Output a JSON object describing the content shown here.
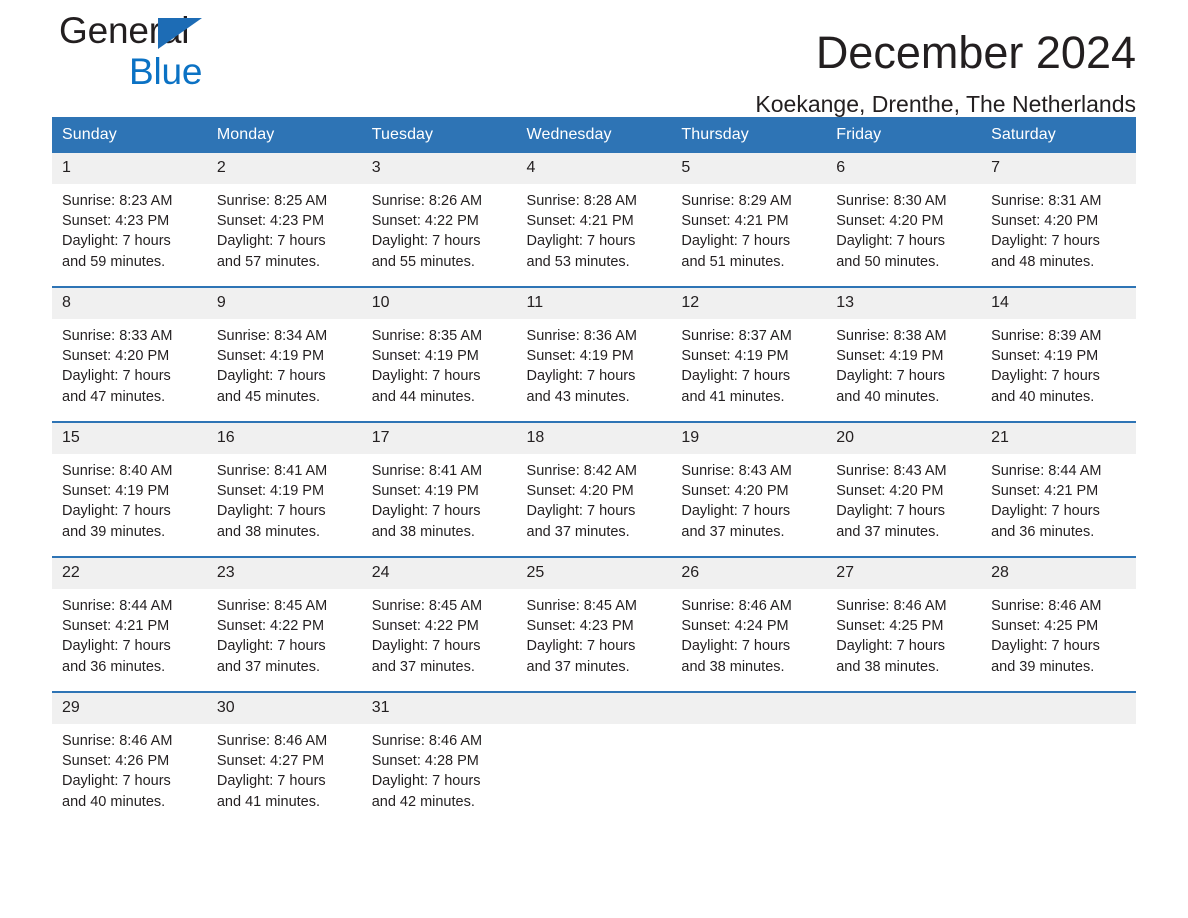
{
  "brand": {
    "line1": "General",
    "line2": "Blue",
    "triangle_color": "#1d6cb5",
    "blue_color": "#0b72c4"
  },
  "header": {
    "title": "December 2024",
    "subtitle": "Koekange, Drenthe, The Netherlands"
  },
  "theme": {
    "header_blue": "#2e74b5",
    "daynum_gray": "#f0f0f0",
    "text": "#231f20"
  },
  "weekdays": [
    "Sunday",
    "Monday",
    "Tuesday",
    "Wednesday",
    "Thursday",
    "Friday",
    "Saturday"
  ],
  "weeks": [
    [
      {
        "day": "1",
        "sunrise": "Sunrise: 8:23 AM",
        "sunset": "Sunset: 4:23 PM",
        "daylight1": "Daylight: 7 hours",
        "daylight2": "and 59 minutes."
      },
      {
        "day": "2",
        "sunrise": "Sunrise: 8:25 AM",
        "sunset": "Sunset: 4:23 PM",
        "daylight1": "Daylight: 7 hours",
        "daylight2": "and 57 minutes."
      },
      {
        "day": "3",
        "sunrise": "Sunrise: 8:26 AM",
        "sunset": "Sunset: 4:22 PM",
        "daylight1": "Daylight: 7 hours",
        "daylight2": "and 55 minutes."
      },
      {
        "day": "4",
        "sunrise": "Sunrise: 8:28 AM",
        "sunset": "Sunset: 4:21 PM",
        "daylight1": "Daylight: 7 hours",
        "daylight2": "and 53 minutes."
      },
      {
        "day": "5",
        "sunrise": "Sunrise: 8:29 AM",
        "sunset": "Sunset: 4:21 PM",
        "daylight1": "Daylight: 7 hours",
        "daylight2": "and 51 minutes."
      },
      {
        "day": "6",
        "sunrise": "Sunrise: 8:30 AM",
        "sunset": "Sunset: 4:20 PM",
        "daylight1": "Daylight: 7 hours",
        "daylight2": "and 50 minutes."
      },
      {
        "day": "7",
        "sunrise": "Sunrise: 8:31 AM",
        "sunset": "Sunset: 4:20 PM",
        "daylight1": "Daylight: 7 hours",
        "daylight2": "and 48 minutes."
      }
    ],
    [
      {
        "day": "8",
        "sunrise": "Sunrise: 8:33 AM",
        "sunset": "Sunset: 4:20 PM",
        "daylight1": "Daylight: 7 hours",
        "daylight2": "and 47 minutes."
      },
      {
        "day": "9",
        "sunrise": "Sunrise: 8:34 AM",
        "sunset": "Sunset: 4:19 PM",
        "daylight1": "Daylight: 7 hours",
        "daylight2": "and 45 minutes."
      },
      {
        "day": "10",
        "sunrise": "Sunrise: 8:35 AM",
        "sunset": "Sunset: 4:19 PM",
        "daylight1": "Daylight: 7 hours",
        "daylight2": "and 44 minutes."
      },
      {
        "day": "11",
        "sunrise": "Sunrise: 8:36 AM",
        "sunset": "Sunset: 4:19 PM",
        "daylight1": "Daylight: 7 hours",
        "daylight2": "and 43 minutes."
      },
      {
        "day": "12",
        "sunrise": "Sunrise: 8:37 AM",
        "sunset": "Sunset: 4:19 PM",
        "daylight1": "Daylight: 7 hours",
        "daylight2": "and 41 minutes."
      },
      {
        "day": "13",
        "sunrise": "Sunrise: 8:38 AM",
        "sunset": "Sunset: 4:19 PM",
        "daylight1": "Daylight: 7 hours",
        "daylight2": "and 40 minutes."
      },
      {
        "day": "14",
        "sunrise": "Sunrise: 8:39 AM",
        "sunset": "Sunset: 4:19 PM",
        "daylight1": "Daylight: 7 hours",
        "daylight2": "and 40 minutes."
      }
    ],
    [
      {
        "day": "15",
        "sunrise": "Sunrise: 8:40 AM",
        "sunset": "Sunset: 4:19 PM",
        "daylight1": "Daylight: 7 hours",
        "daylight2": "and 39 minutes."
      },
      {
        "day": "16",
        "sunrise": "Sunrise: 8:41 AM",
        "sunset": "Sunset: 4:19 PM",
        "daylight1": "Daylight: 7 hours",
        "daylight2": "and 38 minutes."
      },
      {
        "day": "17",
        "sunrise": "Sunrise: 8:41 AM",
        "sunset": "Sunset: 4:19 PM",
        "daylight1": "Daylight: 7 hours",
        "daylight2": "and 38 minutes."
      },
      {
        "day": "18",
        "sunrise": "Sunrise: 8:42 AM",
        "sunset": "Sunset: 4:20 PM",
        "daylight1": "Daylight: 7 hours",
        "daylight2": "and 37 minutes."
      },
      {
        "day": "19",
        "sunrise": "Sunrise: 8:43 AM",
        "sunset": "Sunset: 4:20 PM",
        "daylight1": "Daylight: 7 hours",
        "daylight2": "and 37 minutes."
      },
      {
        "day": "20",
        "sunrise": "Sunrise: 8:43 AM",
        "sunset": "Sunset: 4:20 PM",
        "daylight1": "Daylight: 7 hours",
        "daylight2": "and 37 minutes."
      },
      {
        "day": "21",
        "sunrise": "Sunrise: 8:44 AM",
        "sunset": "Sunset: 4:21 PM",
        "daylight1": "Daylight: 7 hours",
        "daylight2": "and 36 minutes."
      }
    ],
    [
      {
        "day": "22",
        "sunrise": "Sunrise: 8:44 AM",
        "sunset": "Sunset: 4:21 PM",
        "daylight1": "Daylight: 7 hours",
        "daylight2": "and 36 minutes."
      },
      {
        "day": "23",
        "sunrise": "Sunrise: 8:45 AM",
        "sunset": "Sunset: 4:22 PM",
        "daylight1": "Daylight: 7 hours",
        "daylight2": "and 37 minutes."
      },
      {
        "day": "24",
        "sunrise": "Sunrise: 8:45 AM",
        "sunset": "Sunset: 4:22 PM",
        "daylight1": "Daylight: 7 hours",
        "daylight2": "and 37 minutes."
      },
      {
        "day": "25",
        "sunrise": "Sunrise: 8:45 AM",
        "sunset": "Sunset: 4:23 PM",
        "daylight1": "Daylight: 7 hours",
        "daylight2": "and 37 minutes."
      },
      {
        "day": "26",
        "sunrise": "Sunrise: 8:46 AM",
        "sunset": "Sunset: 4:24 PM",
        "daylight1": "Daylight: 7 hours",
        "daylight2": "and 38 minutes."
      },
      {
        "day": "27",
        "sunrise": "Sunrise: 8:46 AM",
        "sunset": "Sunset: 4:25 PM",
        "daylight1": "Daylight: 7 hours",
        "daylight2": "and 38 minutes."
      },
      {
        "day": "28",
        "sunrise": "Sunrise: 8:46 AM",
        "sunset": "Sunset: 4:25 PM",
        "daylight1": "Daylight: 7 hours",
        "daylight2": "and 39 minutes."
      }
    ],
    [
      {
        "day": "29",
        "sunrise": "Sunrise: 8:46 AM",
        "sunset": "Sunset: 4:26 PM",
        "daylight1": "Daylight: 7 hours",
        "daylight2": "and 40 minutes."
      },
      {
        "day": "30",
        "sunrise": "Sunrise: 8:46 AM",
        "sunset": "Sunset: 4:27 PM",
        "daylight1": "Daylight: 7 hours",
        "daylight2": "and 41 minutes."
      },
      {
        "day": "31",
        "sunrise": "Sunrise: 8:46 AM",
        "sunset": "Sunset: 4:28 PM",
        "daylight1": "Daylight: 7 hours",
        "daylight2": "and 42 minutes."
      },
      {
        "day": "",
        "sunrise": "",
        "sunset": "",
        "daylight1": "",
        "daylight2": ""
      },
      {
        "day": "",
        "sunrise": "",
        "sunset": "",
        "daylight1": "",
        "daylight2": ""
      },
      {
        "day": "",
        "sunrise": "",
        "sunset": "",
        "daylight1": "",
        "daylight2": ""
      },
      {
        "day": "",
        "sunrise": "",
        "sunset": "",
        "daylight1": "",
        "daylight2": ""
      }
    ]
  ]
}
